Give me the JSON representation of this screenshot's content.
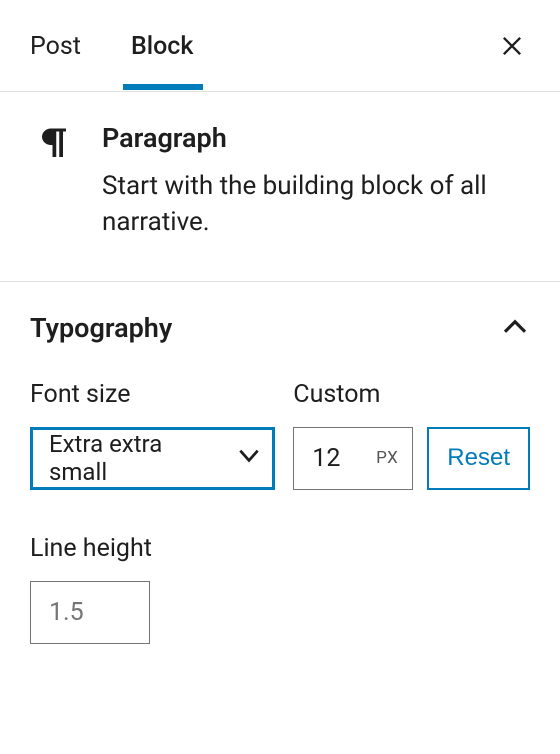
{
  "tabs": {
    "post": "Post",
    "block": "Block"
  },
  "block": {
    "title": "Paragraph",
    "description": "Start with the building block of all narrative."
  },
  "typography": {
    "title": "Typography",
    "fontSize": {
      "label": "Font size",
      "selected": "Extra extra small"
    },
    "custom": {
      "label": "Custom",
      "value": "12",
      "unit": "PX"
    },
    "reset": "Reset",
    "lineHeight": {
      "label": "Line height",
      "placeholder": "1.5"
    }
  }
}
